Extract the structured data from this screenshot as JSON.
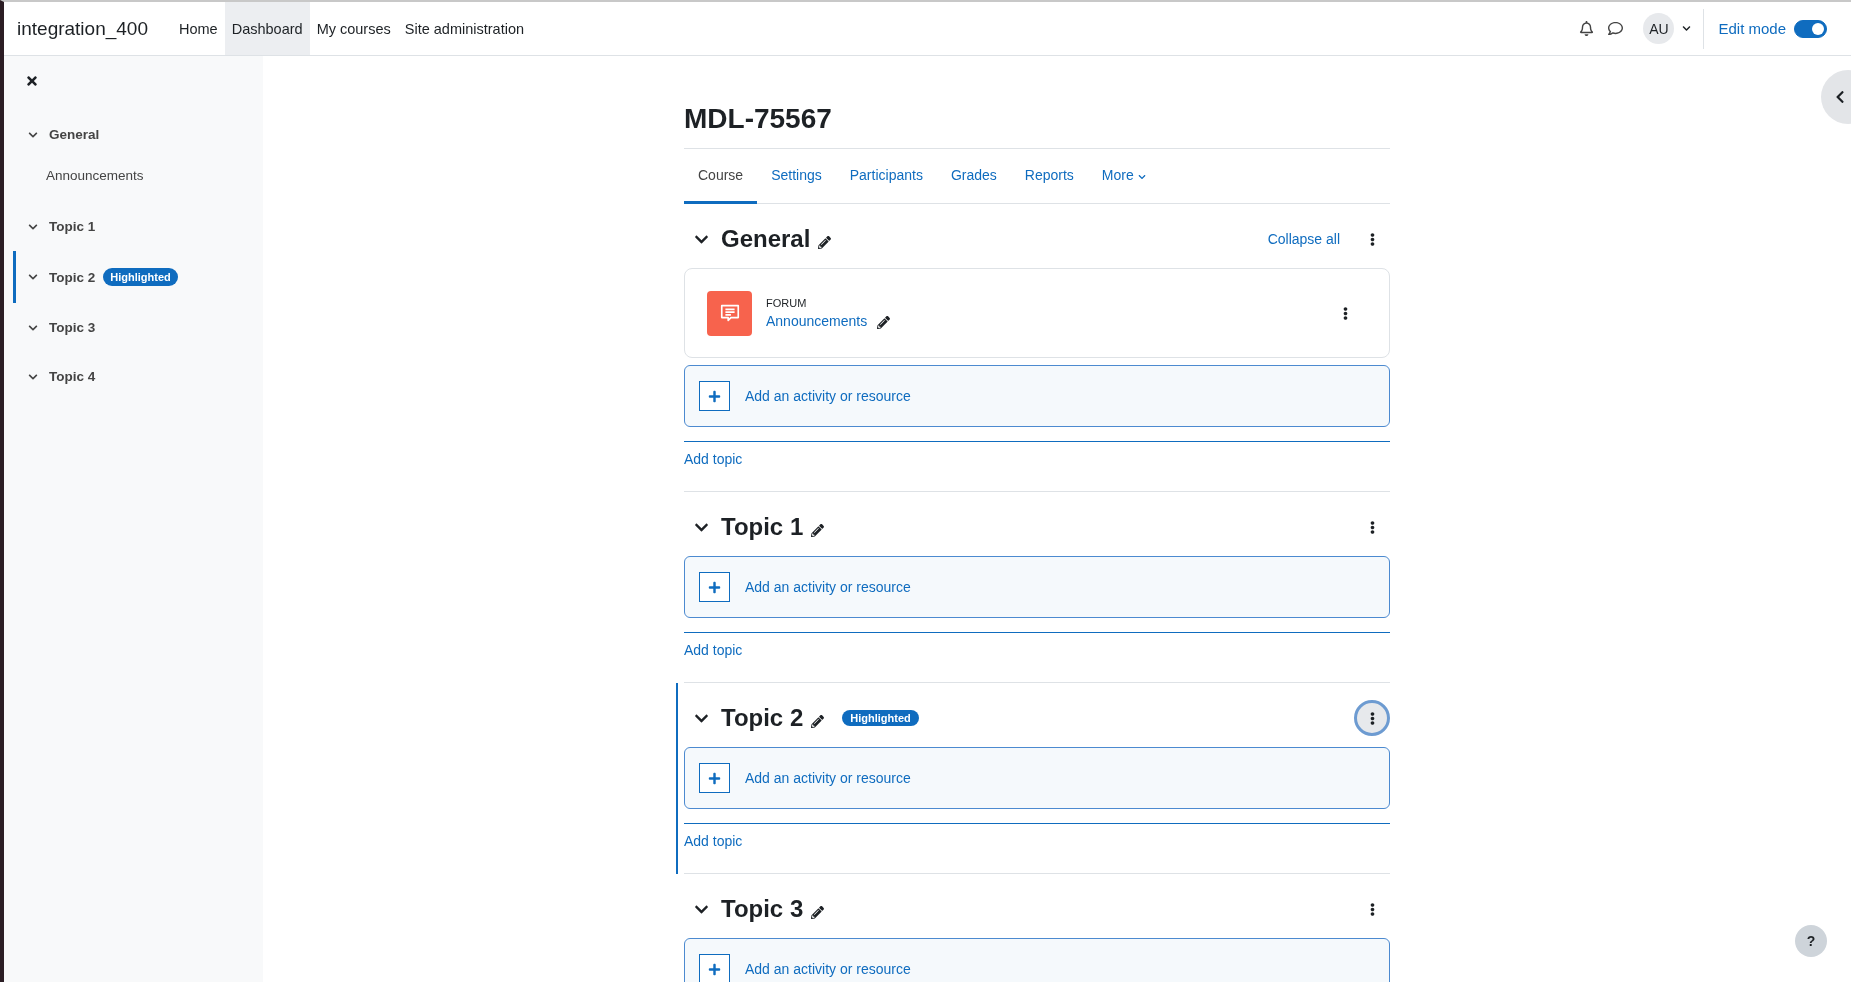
{
  "navbar": {
    "site_name": "integration_400",
    "links": [
      {
        "label": "Home",
        "selected": false
      },
      {
        "label": "Dashboard",
        "selected": true
      },
      {
        "label": "My courses",
        "selected": false
      },
      {
        "label": "Site administration",
        "selected": false
      }
    ],
    "user_initials": "AU",
    "edit_mode": {
      "label": "Edit mode",
      "on": true
    }
  },
  "course_index": {
    "items": [
      {
        "title": "General",
        "expanded": true,
        "highlighted": false,
        "children": [
          {
            "label": "Announcements"
          }
        ]
      },
      {
        "title": "Topic 1",
        "expanded": true,
        "highlighted": false
      },
      {
        "title": "Topic 2",
        "expanded": true,
        "highlighted": true,
        "badge": "Highlighted"
      },
      {
        "title": "Topic 3",
        "expanded": true,
        "highlighted": false
      },
      {
        "title": "Topic 4",
        "expanded": true,
        "highlighted": false
      }
    ]
  },
  "course": {
    "title": "MDL-75567",
    "tabs": [
      {
        "label": "Course",
        "selected": true,
        "kind": "link"
      },
      {
        "label": "Settings",
        "selected": false,
        "kind": "link"
      },
      {
        "label": "Participants",
        "selected": false,
        "kind": "link"
      },
      {
        "label": "Grades",
        "selected": false,
        "kind": "link"
      },
      {
        "label": "Reports",
        "selected": false,
        "kind": "link"
      },
      {
        "label": "More",
        "selected": false,
        "kind": "menu"
      }
    ],
    "collapse_all": "Collapse all",
    "sections": [
      {
        "title": "General",
        "expanded": true,
        "highlighted": false,
        "menu_focused": false,
        "activities": [
          {
            "type": "FORUM",
            "name": "Announcements"
          }
        ],
        "add_activity": "Add an activity or resource",
        "add_topic": "Add topic"
      },
      {
        "title": "Topic 1",
        "expanded": true,
        "highlighted": false,
        "menu_focused": false,
        "add_activity": "Add an activity or resource",
        "add_topic": "Add topic"
      },
      {
        "title": "Topic 2",
        "expanded": true,
        "highlighted": true,
        "badge": "Highlighted",
        "menu_focused": true,
        "add_activity": "Add an activity or resource",
        "add_topic": "Add topic"
      },
      {
        "title": "Topic 3",
        "expanded": true,
        "highlighted": false,
        "menu_focused": false,
        "add_activity": "Add an activity or resource"
      }
    ]
  },
  "help_button": "?"
}
